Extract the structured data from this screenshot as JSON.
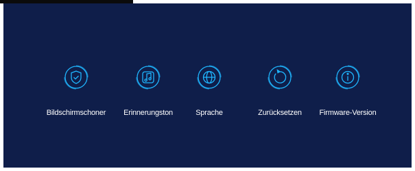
{
  "colors": {
    "panel_background": "#0f1e4a",
    "icon_stroke": "#1fb6ff",
    "label_text": "#ffffff"
  },
  "menu": {
    "items": [
      {
        "icon": "shield-check-icon",
        "label": "Bildschirmschoner"
      },
      {
        "icon": "music-note-icon",
        "label": "Erinnerungston"
      },
      {
        "icon": "globe-icon",
        "label": "Sprache"
      },
      {
        "icon": "reset-icon",
        "label": "Zurücksetzen"
      },
      {
        "icon": "info-icon",
        "label": "Firmware-Version"
      }
    ]
  }
}
